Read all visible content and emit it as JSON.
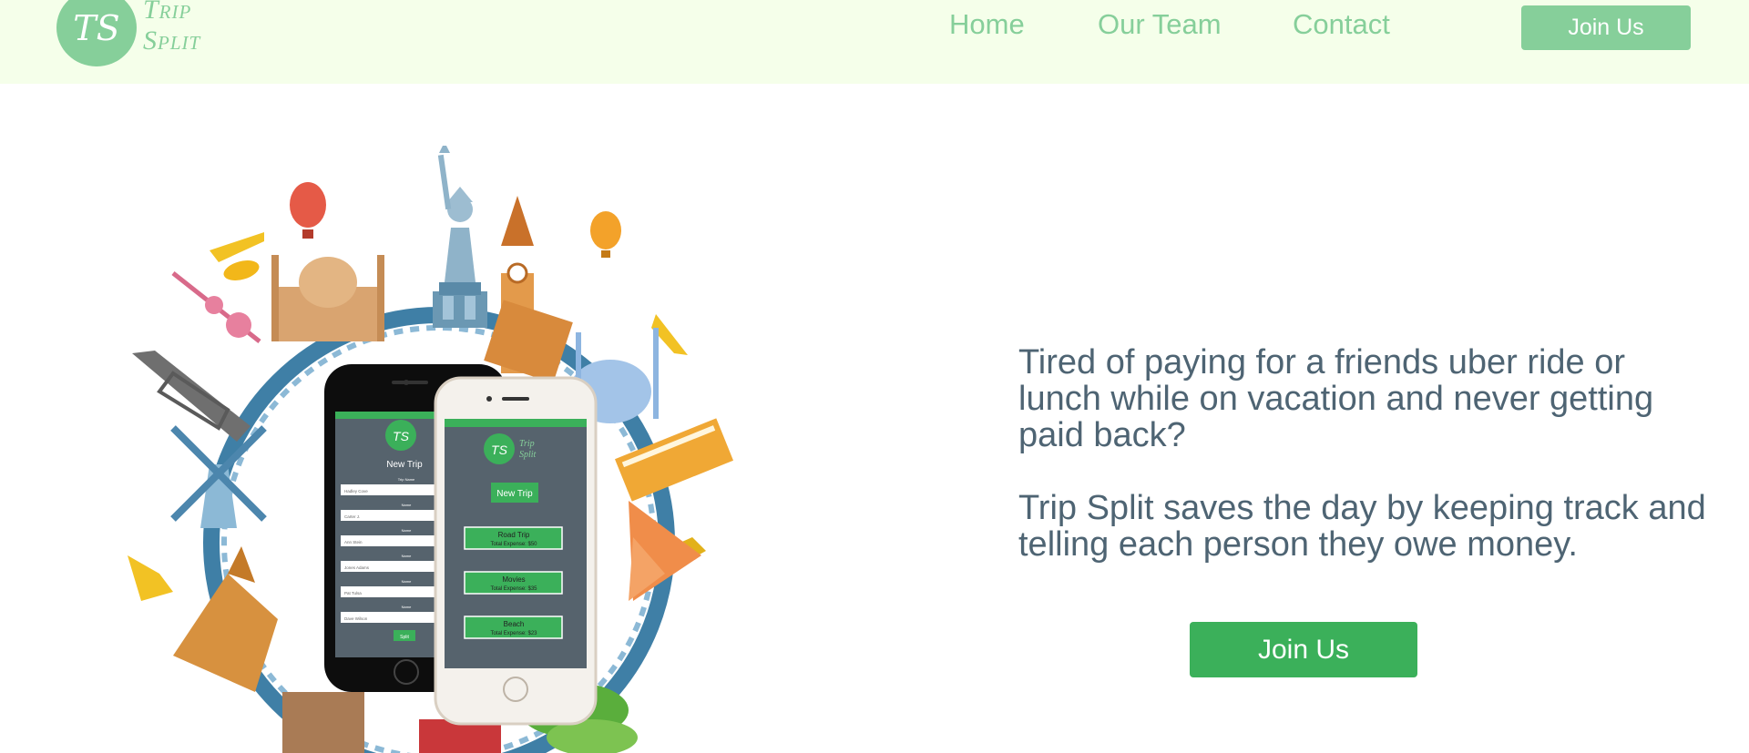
{
  "header": {
    "logo_initials": "TS",
    "logo_line1": "Trip",
    "logo_line2": "Split",
    "nav": [
      {
        "label": "Home"
      },
      {
        "label": "Our Team"
      },
      {
        "label": "Contact"
      }
    ],
    "join_button": "Join Us"
  },
  "hero": {
    "paragraph1": "Tired of paying for a friends uber ride or lunch while on vacation and never getting paid back?",
    "paragraph2": "Trip Split saves the day by keeping track and telling each person they owe money.",
    "cta_button": "Join Us"
  },
  "phone_back": {
    "logo_initials": "TS",
    "title": "New Trip",
    "field_label_first": "Trip Name",
    "field_label": "Name",
    "fields": [
      "Hadley Cove",
      "Carter J.",
      "Ann Stein",
      "Jones Adams",
      "Pat Tulsa",
      "Dave Wilson"
    ],
    "button": "Split"
  },
  "phone_front": {
    "logo_initials": "TS",
    "logo_line1": "Trip",
    "logo_line2": "Split",
    "new_trip_button": "New Trip",
    "trips": [
      {
        "name": "Road Trip",
        "expense": "Total Expense: $50"
      },
      {
        "name": "Movies",
        "expense": "Total Expense: $35"
      },
      {
        "name": "Beach",
        "expense": "Total Expense: $23"
      }
    ]
  },
  "colors": {
    "header_bg": "#f5ffea",
    "brand_green_light": "#86cf9a",
    "brand_green": "#3bb05a",
    "body_text": "#4e6473"
  }
}
